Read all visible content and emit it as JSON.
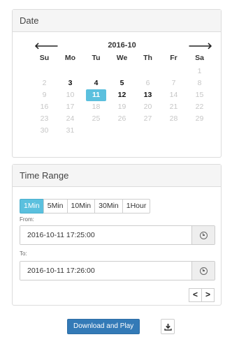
{
  "date_panel": {
    "title": "Date",
    "month_label": "2016-10",
    "prev_glyph": "🡐",
    "next_glyph": "🡒",
    "weekdays": [
      "Su",
      "Mo",
      "Tu",
      "We",
      "Th",
      "Fr",
      "Sa"
    ],
    "weeks": [
      [
        {
          "d": "",
          "s": "muted"
        },
        {
          "d": "",
          "s": "muted"
        },
        {
          "d": "",
          "s": "muted"
        },
        {
          "d": "",
          "s": "muted"
        },
        {
          "d": "",
          "s": "muted"
        },
        {
          "d": "",
          "s": "muted"
        },
        {
          "d": "1",
          "s": "muted"
        }
      ],
      [
        {
          "d": "2",
          "s": "muted"
        },
        {
          "d": "3",
          "s": "active"
        },
        {
          "d": "4",
          "s": "active"
        },
        {
          "d": "5",
          "s": "active"
        },
        {
          "d": "6",
          "s": "muted"
        },
        {
          "d": "7",
          "s": "muted"
        },
        {
          "d": "8",
          "s": "muted"
        }
      ],
      [
        {
          "d": "9",
          "s": "muted"
        },
        {
          "d": "10",
          "s": "muted"
        },
        {
          "d": "11",
          "s": "selected"
        },
        {
          "d": "12",
          "s": "active"
        },
        {
          "d": "13",
          "s": "active"
        },
        {
          "d": "14",
          "s": "muted"
        },
        {
          "d": "15",
          "s": "muted"
        }
      ],
      [
        {
          "d": "16",
          "s": "muted"
        },
        {
          "d": "17",
          "s": "muted"
        },
        {
          "d": "18",
          "s": "muted"
        },
        {
          "d": "19",
          "s": "muted"
        },
        {
          "d": "20",
          "s": "muted"
        },
        {
          "d": "21",
          "s": "muted"
        },
        {
          "d": "22",
          "s": "muted"
        }
      ],
      [
        {
          "d": "23",
          "s": "muted"
        },
        {
          "d": "24",
          "s": "muted"
        },
        {
          "d": "25",
          "s": "muted"
        },
        {
          "d": "26",
          "s": "muted"
        },
        {
          "d": "27",
          "s": "muted"
        },
        {
          "d": "28",
          "s": "muted"
        },
        {
          "d": "29",
          "s": "muted"
        }
      ],
      [
        {
          "d": "30",
          "s": "muted"
        },
        {
          "d": "31",
          "s": "muted"
        },
        {
          "d": "",
          "s": "muted"
        },
        {
          "d": "",
          "s": "muted"
        },
        {
          "d": "",
          "s": "muted"
        },
        {
          "d": "",
          "s": "muted"
        },
        {
          "d": "",
          "s": "muted"
        }
      ]
    ]
  },
  "time_panel": {
    "title": "Time Range",
    "ranges": [
      "1Min",
      "5Min",
      "10Min",
      "30Min",
      "1Hour"
    ],
    "active_range": "1Min",
    "from_label": "From:",
    "from_value": "2016-10-11 17:25:00",
    "to_label": "To:",
    "to_value": "2016-10-11 17:26:00",
    "prev_label": "<",
    "next_label": ">"
  },
  "actions": {
    "download_label": "Download and Play"
  },
  "colors": {
    "accent": "#5bc0de",
    "primary": "#337ab7"
  },
  "icons": {
    "from_addon": "clock-icon",
    "to_addon": "clock-icon",
    "save": "download-icon"
  }
}
